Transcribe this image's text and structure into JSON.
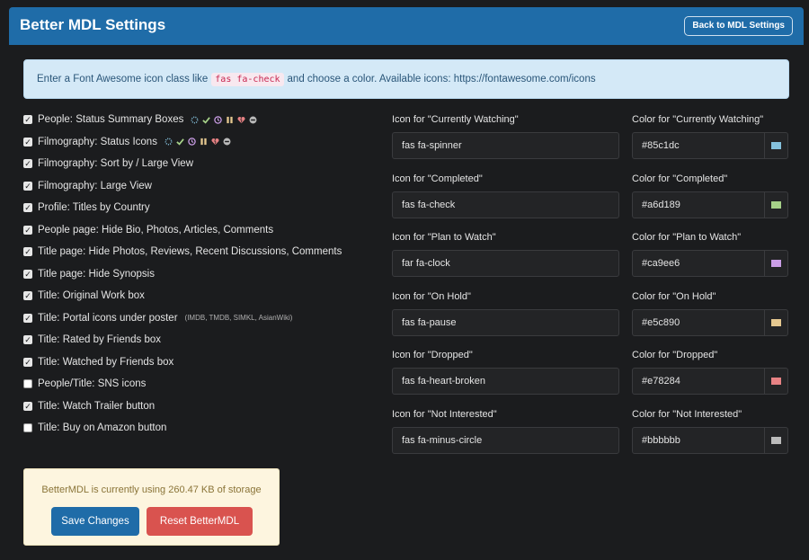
{
  "header": {
    "title": "Better MDL Settings",
    "back_label": "Back to MDL Settings"
  },
  "info": {
    "before": "Enter a Font Awesome icon class like",
    "code": "fas fa-check",
    "after": "and choose a color. Available icons: https://fontawesome.com/icons"
  },
  "options": [
    {
      "label": "People: Status Summary Boxes",
      "checked": true,
      "icons": true
    },
    {
      "label": "Filmography: Status Icons",
      "checked": true,
      "icons": true
    },
    {
      "label": "Filmography: Sort by / Large View",
      "checked": true
    },
    {
      "label": "Filmography: Large View",
      "checked": true
    },
    {
      "label": "Profile: Titles by Country",
      "checked": true
    },
    {
      "label": "People page: Hide Bio, Photos, Articles, Comments",
      "checked": true
    },
    {
      "label": "Title page: Hide Photos, Reviews, Recent Discussions, Comments",
      "checked": true
    },
    {
      "label": "Title page: Hide Synopsis",
      "checked": true
    },
    {
      "label": "Title: Original Work box",
      "checked": true
    },
    {
      "label": "Title: Portal icons under poster",
      "checked": true,
      "hint": "(IMDB, TMDB, SIMKL, AsianWiki)"
    },
    {
      "label": "Title: Rated by Friends box",
      "checked": true
    },
    {
      "label": "Title: Watched by Friends box",
      "checked": true
    },
    {
      "label": "People/Title: SNS icons",
      "checked": false
    },
    {
      "label": "Title: Watch Trailer button",
      "checked": true
    },
    {
      "label": "Title: Buy on Amazon button",
      "checked": false
    }
  ],
  "status_icons": [
    {
      "icon": "spinner-icon",
      "color": "#85c1dc"
    },
    {
      "icon": "check-icon",
      "color": "#a6d189"
    },
    {
      "icon": "clock-icon",
      "color": "#ca9ee6"
    },
    {
      "icon": "pause-icon",
      "color": "#e5c890"
    },
    {
      "icon": "heart-broken-icon",
      "color": "#e78284"
    },
    {
      "icon": "minus-circle-icon",
      "color": "#bbbbbb"
    }
  ],
  "statuses": [
    {
      "icon_label": "Icon for \"Currently Watching\"",
      "icon_value": "fas fa-spinner",
      "color_label": "Color for \"Currently Watching\"",
      "color_value": "#85c1dc"
    },
    {
      "icon_label": "Icon for \"Completed\"",
      "icon_value": "fas fa-check",
      "color_label": "Color for \"Completed\"",
      "color_value": "#a6d189"
    },
    {
      "icon_label": "Icon for \"Plan to Watch\"",
      "icon_value": "far fa-clock",
      "color_label": "Color for \"Plan to Watch\"",
      "color_value": "#ca9ee6"
    },
    {
      "icon_label": "Icon for \"On Hold\"",
      "icon_value": "fas fa-pause",
      "color_label": "Color for \"On Hold\"",
      "color_value": "#e5c890"
    },
    {
      "icon_label": "Icon for \"Dropped\"",
      "icon_value": "fas fa-heart-broken",
      "color_label": "Color for \"Dropped\"",
      "color_value": "#e78284"
    },
    {
      "icon_label": "Icon for \"Not Interested\"",
      "icon_value": "fas fa-minus-circle",
      "color_label": "Color for \"Not Interested\"",
      "color_value": "#bbbbbb"
    }
  ],
  "storage": {
    "text": "BetterMDL is currently using 260.47 KB of storage",
    "save_label": "Save Changes",
    "reset_label": "Reset BetterMDL"
  }
}
